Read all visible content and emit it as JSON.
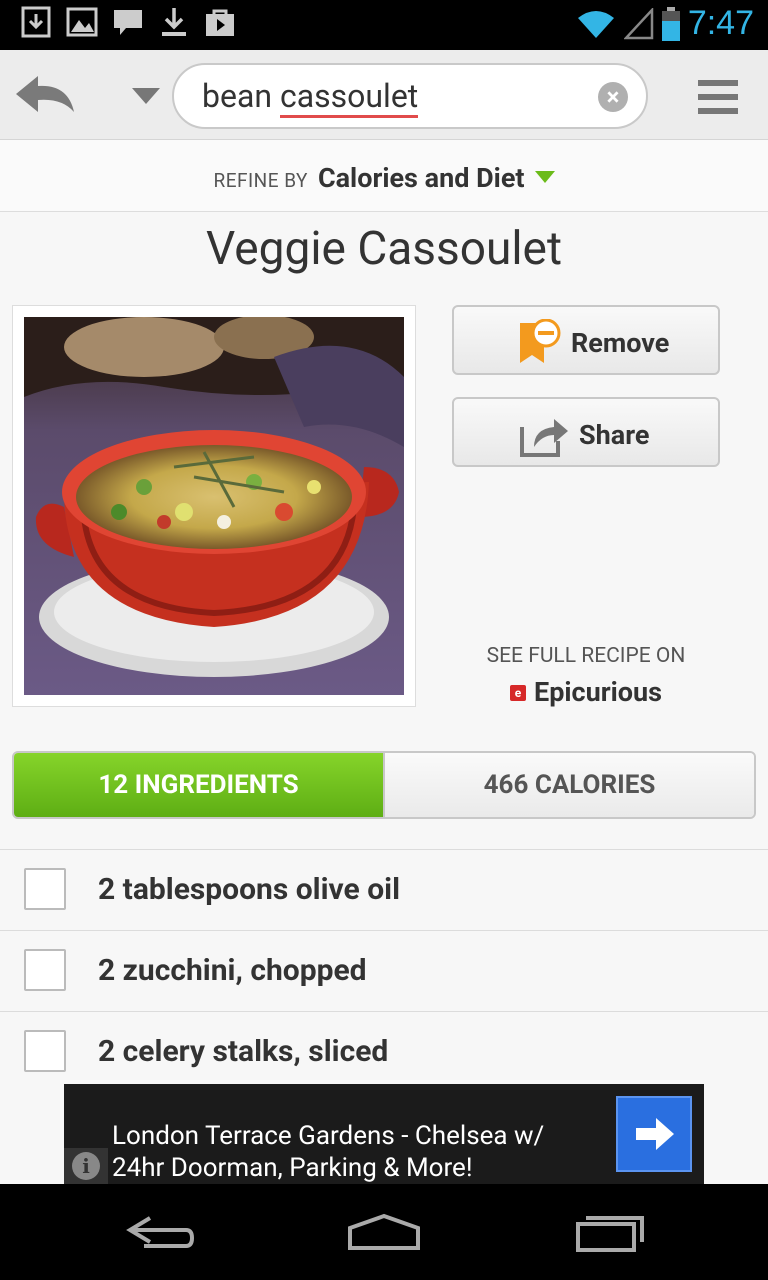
{
  "status_bar": {
    "time": "7:47",
    "icons": [
      "download-notification-icon",
      "image-notification-icon",
      "chat-notification-icon",
      "download-complete-icon",
      "shopping-bag-icon",
      "wifi-icon",
      "signal-icon",
      "battery-icon"
    ]
  },
  "toolbar": {
    "search_query": "bean cassoulet",
    "search_plain": "bean ",
    "search_misspelled": "cassoulet"
  },
  "refine": {
    "label": "REFINE BY",
    "value": "Calories and Diet"
  },
  "recipe": {
    "title": "Veggie Cassoulet",
    "remove_label": "Remove",
    "share_label": "Share",
    "see_full_label": "SEE FULL RECIPE ON",
    "source_name": "Epicurious",
    "source_logo_letter": "e"
  },
  "tabs": [
    {
      "label": "12 INGREDIENTS",
      "active": true
    },
    {
      "label": "466 CALORIES",
      "active": false
    }
  ],
  "ingredients": [
    "2 tablespoons olive oil",
    "2 zucchini, chopped",
    "2 celery stalks, sliced"
  ],
  "ad": {
    "text": "London Terrace Gardens - Chelsea w/ 24hr Doorman, Parking & More!",
    "info_glyph": "i"
  },
  "colors": {
    "accent_green": "#6bbb1a",
    "clock_blue": "#33b5e5",
    "ad_button_blue": "#2a6fe0"
  }
}
